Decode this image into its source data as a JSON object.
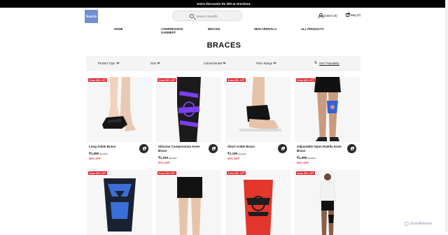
{
  "announcement": "Extra discounts Rs 300 at checkout.",
  "brand": {
    "logo_text": "Snick"
  },
  "search": {
    "placeholder": "Search Snickfit"
  },
  "header": {
    "orders_label": "Orders (0)",
    "bag_label": "Bag (0)"
  },
  "nav": {
    "items": [
      {
        "label": "HOME"
      },
      {
        "label": "COMPRESSION\nGARMENT"
      },
      {
        "label": "BRACES"
      },
      {
        "label": "NEW ARRIVALS"
      },
      {
        "label": "ALL PRODUCTS"
      }
    ]
  },
  "page_title": "BRACES",
  "filters": {
    "product_type": "Product Type",
    "size": "Size",
    "colour": "Colour/Variant",
    "price": "Price Range",
    "sort": "Sort: Popularity"
  },
  "products": [
    {
      "badge": "Extra 50% OFF",
      "name": "Long Ankle Brace",
      "price": "₹1,599",
      "mrp": "₹3,399",
      "off": "52% OFF",
      "image": "ankle-brace-black"
    },
    {
      "badge": "Extra 50% OFF",
      "name": "Silicone Compression Knee Brace",
      "price": "₹1,293",
      "mrp": "₹2,999",
      "off": "57% OFF",
      "image": "knee-brace-purple"
    },
    {
      "badge": "Extra 50% OFF",
      "name": "Short Ankle Brace",
      "price": "₹1,199",
      "mrp": "₹2,499",
      "off": "52% OFF",
      "image": "short-ankle-brace"
    },
    {
      "badge": "Extra 50% OFF",
      "name": "Adjustable Open Patella Knee Brace",
      "price": "₹1,599",
      "mrp": "₹3,399",
      "off": "52% OFF",
      "image": "open-patella-knee-brace"
    },
    {
      "badge": "Extra 50% OFF",
      "image": "knee-sleeve-blue"
    },
    {
      "badge": "Extra 50% OFF",
      "image": "thigh-compression"
    },
    {
      "badge": "Extra 50% OFF",
      "image": "knee-sleeve-red"
    },
    {
      "badge": "Extra 50% OFF",
      "image": "full-body-wrap"
    }
  ],
  "watermark": "ScanMalware",
  "colors": {
    "badge": "#e11b22",
    "off": "#e11b22",
    "topbar": "#000000",
    "logo": "#6f8fd1"
  }
}
